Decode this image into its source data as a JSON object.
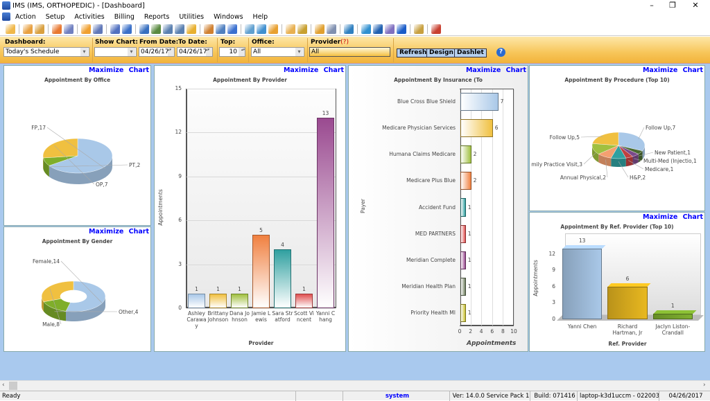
{
  "window": {
    "title": "IMS (IMS, ORTHOPEDIC)  - [Dashboard]",
    "minimize": "–",
    "restore": "❐",
    "close": "✕"
  },
  "menu": [
    "Action",
    "Setup",
    "Activities",
    "Billing",
    "Reports",
    "Utilities",
    "Windows",
    "Help"
  ],
  "toolbar_colors": [
    "#f0b84a",
    "#e8a040",
    "#d9a040",
    "#e87830",
    "#7080c0",
    "#f0a030",
    "#6078b8",
    "#5070c0",
    "#3a70c8",
    "#3870c0",
    "#5a8a40",
    "#5a80b0",
    "#5a80b0",
    "#e8b030",
    "#d08030",
    "#5080c0",
    "#3a70d0",
    "#60a0d0",
    "#4090d0",
    "#e8a030",
    "#e8b050",
    "#c8a030",
    "#e0a030",
    "#8090b0",
    "#3080c0",
    "#3090d0",
    "#2060b0",
    "#8070c0",
    "#1a5cc8",
    "#c8a040",
    "#c84030"
  ],
  "filters": {
    "dashboard_label": "Dashboard:",
    "dashboard_value": "Today's Schedule",
    "show_chart_label": "Show Chart:",
    "show_chart_value": "",
    "from_label": "From Date:",
    "from_value": "04/26/17",
    "to_label": "To Date:",
    "to_value": "04/26/17",
    "top_label": "Top:",
    "top_value": "10",
    "office_label": "Office:",
    "office_value": "All",
    "provider_label": "Provider",
    "provider_help": "(?)",
    "provider_value": "All",
    "refresh": "Refresh",
    "design": "Design",
    "dashlet": "Dashlet",
    "help_icon": "?"
  },
  "maximize_label": "Maximize  Chart",
  "chart_data": [
    {
      "type": "pie",
      "title": "Appointment By Office",
      "labels": [
        "FP",
        "PT",
        "OP"
      ],
      "values": [
        17,
        2,
        7
      ],
      "colors": [
        "#a9c8e8",
        "#7fae2a",
        "#f0c040"
      ]
    },
    {
      "type": "pie",
      "donut": true,
      "title": "Appointment By Gender",
      "labels": [
        "Female",
        "Other",
        "Male"
      ],
      "values": [
        14,
        4,
        8
      ],
      "colors": [
        "#a9c8e8",
        "#7fae2a",
        "#f0c040"
      ]
    },
    {
      "type": "bar",
      "title": "Appointment By Provider",
      "categories": [
        "Ashley Caraway",
        "Brittany Johnson",
        "Dana Johnson",
        "Jamie Lewis",
        "Sara Stratford",
        "Scott Vincent",
        "Yanni Chang"
      ],
      "values": [
        1,
        1,
        1,
        5,
        4,
        1,
        13
      ],
      "colors": [
        "#a9c8e8",
        "#f0c040",
        "#a0c040",
        "#f08040",
        "#30a0a0",
        "#e05050",
        "#9a4a90"
      ],
      "xlabel": "Provider",
      "ylabel": "Appointments",
      "ylim": [
        0,
        15
      ],
      "yticks": [
        0,
        3,
        6,
        9,
        12,
        15
      ]
    },
    {
      "type": "bar",
      "orientation": "horizontal",
      "title": "Appointment By Insurance (To",
      "categories": [
        "Blue Cross Blue Shield",
        "Medicare Physician Services",
        "Humana Claims Medicare",
        "Medicare Plus Blue",
        "Accident Fund",
        "MED PARTNERS",
        "Meridian Complete",
        "Meridian Health Plan",
        "Priority Health MI"
      ],
      "values": [
        7,
        6,
        2,
        2,
        1,
        1,
        1,
        1,
        1
      ],
      "colors": [
        "#a9c8e8",
        "#f0c040",
        "#a0c040",
        "#f08040",
        "#30a0a0",
        "#e05050",
        "#9a4a90",
        "#708060",
        "#c8c030"
      ],
      "xlabel": "Appointments",
      "ylabel": "Payer",
      "xlim": [
        0,
        10
      ],
      "xticks": [
        0,
        2,
        4,
        6,
        8,
        10
      ]
    },
    {
      "type": "pie",
      "title": "Appointment By Procedure (Top 10)",
      "labels": [
        "Follow Up",
        "New Patient",
        "Multi-Med (Injectio",
        "Medicare",
        "H&P",
        "Annual Physical",
        "mily Practice Visit",
        "Follow Up"
      ],
      "values": [
        7,
        1,
        1,
        1,
        2,
        2,
        3,
        5
      ],
      "colors": [
        "#a9c8e8",
        "#4a6a30",
        "#7a4a8a",
        "#c04040",
        "#30a0a0",
        "#f4a070",
        "#a0c040",
        "#f0c040"
      ]
    },
    {
      "type": "bar",
      "title": "Appointment By Ref. Provider (Top 10)",
      "categories": [
        "Yanni Chen",
        "Richard Hartman, Jr",
        "Jaclyn Liston-Crandall"
      ],
      "values": [
        13,
        6,
        1
      ],
      "colors": [
        "#a9c8e8",
        "#e8b820",
        "#80b030"
      ],
      "xlabel": "Ref. Provider",
      "ylabel": "Appointments",
      "ylim": [
        0,
        15
      ],
      "yticks": [
        0,
        3,
        6,
        9,
        12
      ]
    }
  ],
  "status": {
    "ready": "Ready",
    "user": "system",
    "version": "Ver: 14.0.0 Service Pack 1",
    "build": "Build: 071416",
    "machine": "laptop-k3d1uccm - 0220034",
    "date": "04/26/2017"
  }
}
